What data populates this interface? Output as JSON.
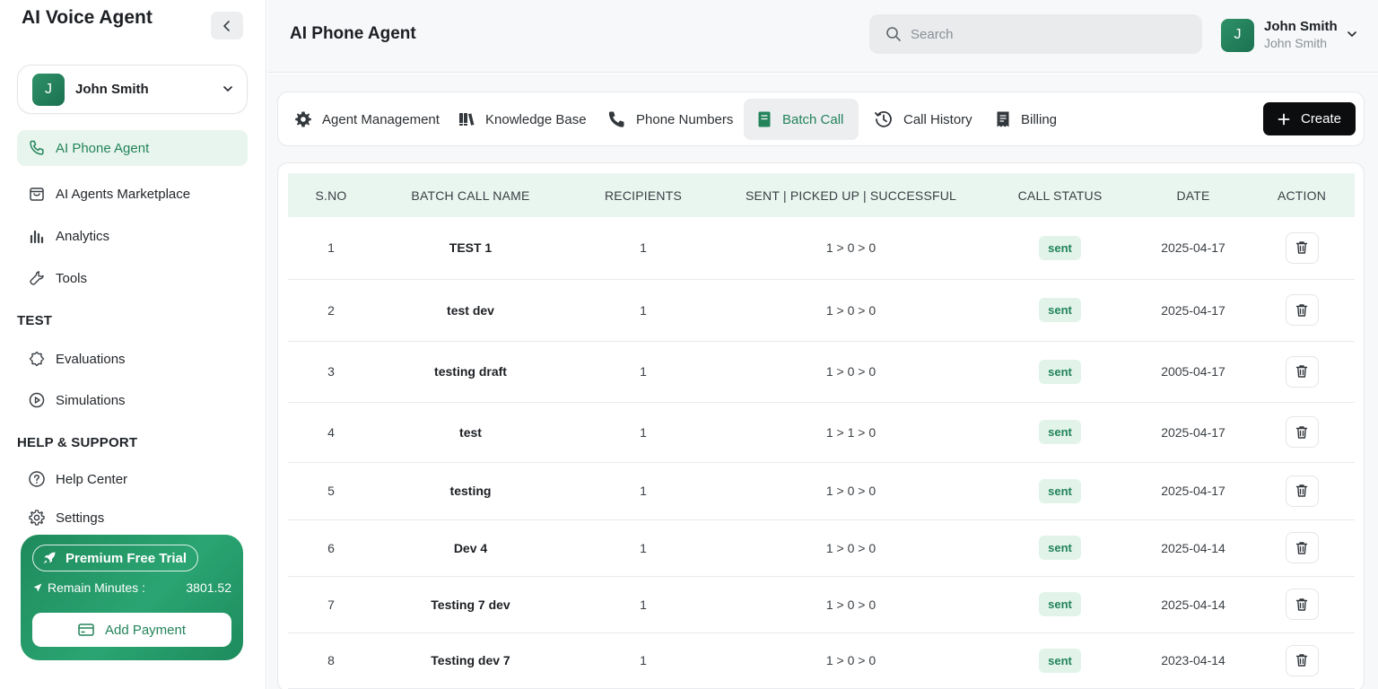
{
  "app": {
    "title": "AI Voice Agent"
  },
  "account": {
    "initial": "J",
    "name": "John Smith"
  },
  "nav": {
    "main": [
      {
        "label": "AI Phone Agent",
        "icon": "phone-icon",
        "active": true
      },
      {
        "label": "AI Agents Marketplace",
        "icon": "marketplace-icon",
        "active": false
      },
      {
        "label": "Analytics",
        "icon": "bar-chart-icon",
        "active": false
      },
      {
        "label": "Tools",
        "icon": "wrench-icon",
        "active": false
      }
    ],
    "test_label": "TEST",
    "test": [
      {
        "label": "Evaluations",
        "icon": "evaluations-icon"
      },
      {
        "label": "Simulations",
        "icon": "play-circle-icon"
      }
    ],
    "support_label": "HELP & SUPPORT",
    "support": [
      {
        "label": "Help Center",
        "icon": "help-circle-icon"
      },
      {
        "label": "Settings",
        "icon": "gear-icon"
      }
    ]
  },
  "trial": {
    "badge": "Premium Free Trial",
    "remain_label": "Remain Minutes :",
    "remain_value": "3801.52",
    "add_payment": "Add Payment"
  },
  "header": {
    "title": "AI Phone Agent",
    "search_placeholder": "Search",
    "user": {
      "initial": "J",
      "name": "John Smith",
      "sub": "John Smith"
    }
  },
  "tabs": [
    {
      "label": "Agent Management",
      "icon": "gear-icon",
      "active": false
    },
    {
      "label": "Knowledge Base",
      "icon": "books-icon",
      "active": false
    },
    {
      "label": "Phone Numbers",
      "icon": "phone-icon",
      "active": false
    },
    {
      "label": "Batch Call",
      "icon": "document-icon",
      "active": true
    },
    {
      "label": "Call History",
      "icon": "history-icon",
      "active": false
    },
    {
      "label": "Billing",
      "icon": "receipt-icon",
      "active": false
    }
  ],
  "create_label": "Create",
  "table": {
    "headers": [
      "S.NO",
      "BATCH CALL NAME",
      "RECIPIENTS",
      "SENT | PICKED UP | SUCCESSFUL",
      "CALL STATUS",
      "DATE",
      "ACTION"
    ],
    "rows": [
      {
        "sno": "1",
        "name": "TEST 1",
        "recipients": "1",
        "progress": "1 > 0 > 0",
        "status": "sent",
        "date": "2025-04-17"
      },
      {
        "sno": "2",
        "name": "test dev",
        "recipients": "1",
        "progress": "1 > 0 > 0",
        "status": "sent",
        "date": "2025-04-17"
      },
      {
        "sno": "3",
        "name": "testing draft",
        "recipients": "1",
        "progress": "1 > 0 > 0",
        "status": "sent",
        "date": "2005-04-17"
      },
      {
        "sno": "4",
        "name": "test",
        "recipients": "1",
        "progress": "1 > 1 > 0",
        "status": "sent",
        "date": "2025-04-17"
      },
      {
        "sno": "5",
        "name": "testing",
        "recipients": "1",
        "progress": "1 > 0 > 0",
        "status": "sent",
        "date": "2025-04-17"
      },
      {
        "sno": "6",
        "name": "Dev 4",
        "recipients": "1",
        "progress": "1 > 0 > 0",
        "status": "sent",
        "date": "2025-04-14"
      },
      {
        "sno": "7",
        "name": "Testing 7 dev",
        "recipients": "1",
        "progress": "1 > 0 > 0",
        "status": "sent",
        "date": "2025-04-14"
      },
      {
        "sno": "8",
        "name": "Testing dev 7",
        "recipients": "1",
        "progress": "1 > 0 > 0",
        "status": "sent",
        "date": "2023-04-14"
      }
    ]
  },
  "colors": {
    "accent": "#23835a",
    "active_bg": "#e8f5ee",
    "header_row_bg": "#e9f6ef",
    "create_bg": "#0c0d0e"
  }
}
